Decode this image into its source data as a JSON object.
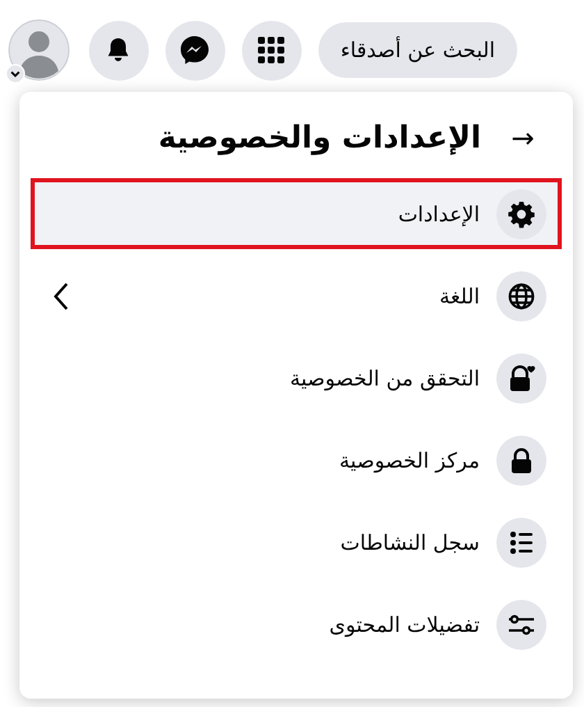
{
  "top_bar": {
    "search_button": "البحث عن أصدقاء"
  },
  "panel": {
    "back_icon": "→",
    "title": "الإعدادات والخصوصية",
    "items": [
      {
        "label": "الإعدادات",
        "selected": true,
        "has_submenu": false
      },
      {
        "label": "اللغة",
        "selected": false,
        "has_submenu": true
      },
      {
        "label": "التحقق من الخصوصية",
        "selected": false,
        "has_submenu": false
      },
      {
        "label": "مركز الخصوصية",
        "selected": false,
        "has_submenu": false
      },
      {
        "label": "سجل النشاطات",
        "selected": false,
        "has_submenu": false
      },
      {
        "label": "تفضيلات المحتوى",
        "selected": false,
        "has_submenu": false
      }
    ]
  }
}
